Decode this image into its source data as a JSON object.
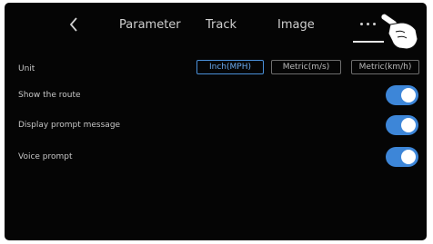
{
  "nav": {
    "back_icon": "chevron-left-icon",
    "tabs": [
      {
        "label": "Parameter"
      },
      {
        "label": "Track"
      },
      {
        "label": "Image"
      }
    ],
    "more_icon": "ellipsis-icon",
    "active_tab": "more"
  },
  "settings": {
    "unit": {
      "label": "Unit",
      "options": [
        "Inch(MPH)",
        "Metric(m/s)",
        "Metric(km/h)"
      ],
      "selected": "Inch(MPH)"
    },
    "toggles": [
      {
        "label": "Show the route",
        "on": true
      },
      {
        "label": "Display prompt message",
        "on": true
      },
      {
        "label": "Voice prompt",
        "on": true
      }
    ]
  },
  "colors": {
    "background": "#050505",
    "accent": "#3d86d8",
    "text": "#c7c7c7"
  }
}
